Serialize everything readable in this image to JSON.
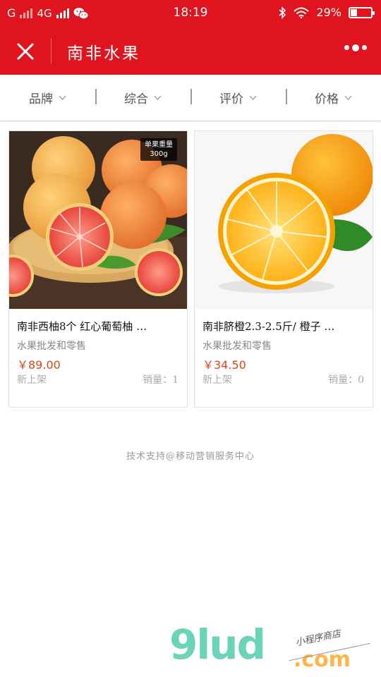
{
  "status_bar": {
    "carrier1": "G",
    "carrier2": "4G",
    "time": "18:19",
    "battery_percent_label": "29%",
    "battery_level": 0.29
  },
  "header": {
    "title": "南非水果",
    "accent_color": "#e0141e"
  },
  "filters": [
    {
      "label": "品牌"
    },
    {
      "label": "综合"
    },
    {
      "label": "评价"
    },
    {
      "label": "价格"
    }
  ],
  "products": [
    {
      "name": "南非西柚8个 红心葡萄柚 …",
      "category": "水果批发和零售",
      "price": "￥89.00",
      "status": "新上架",
      "sales": "销量：1",
      "image_icon": "grapefruit-image",
      "badge_line1": "单果重量",
      "badge_line2": "300g"
    },
    {
      "name": "南非脐橙2.3-2.5斤/ 橙子 …",
      "category": "水果批发和零售",
      "price": "￥34.50",
      "status": "新上架",
      "sales": "销量：0",
      "image_icon": "orange-image"
    }
  ],
  "footer": {
    "support_text": "技术支持@移动营销服务中心"
  },
  "watermark": {
    "brand": "9lud",
    "tld": ".com",
    "tagline": "小程序商店"
  },
  "colors": {
    "price": "#d9481c",
    "watermark_green": "#69d4b7",
    "watermark_orange": "#ffb54a"
  }
}
